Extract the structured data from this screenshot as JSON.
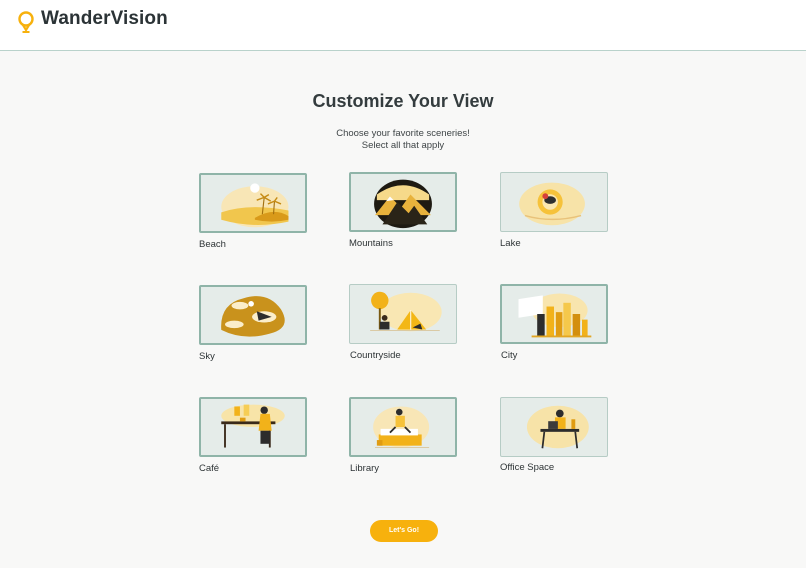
{
  "header": {
    "brand": "WanderVision",
    "logo_icon": "lightbulb-pin-icon"
  },
  "main": {
    "title": "Customize Your View",
    "subtitle_line1": "Choose your favorite sceneries!",
    "subtitle_line2": "Select all that apply"
  },
  "sceneries": [
    {
      "label": "Beach",
      "selected": true
    },
    {
      "label": "Mountains",
      "selected": true
    },
    {
      "label": "Lake",
      "selected": false
    },
    {
      "label": "Sky",
      "selected": true
    },
    {
      "label": "Countryside",
      "selected": false
    },
    {
      "label": "City",
      "selected": true
    },
    {
      "label": "Café",
      "selected": true
    },
    {
      "label": "Library",
      "selected": true
    },
    {
      "label": "Office Space",
      "selected": false
    }
  ],
  "cta": {
    "label": "Let's Go!"
  },
  "colors": {
    "accent": "#f7b10d",
    "tile_background": "#e5ece9",
    "selected_border": "#8fb4a8",
    "header_border": "#b9d2cb"
  }
}
